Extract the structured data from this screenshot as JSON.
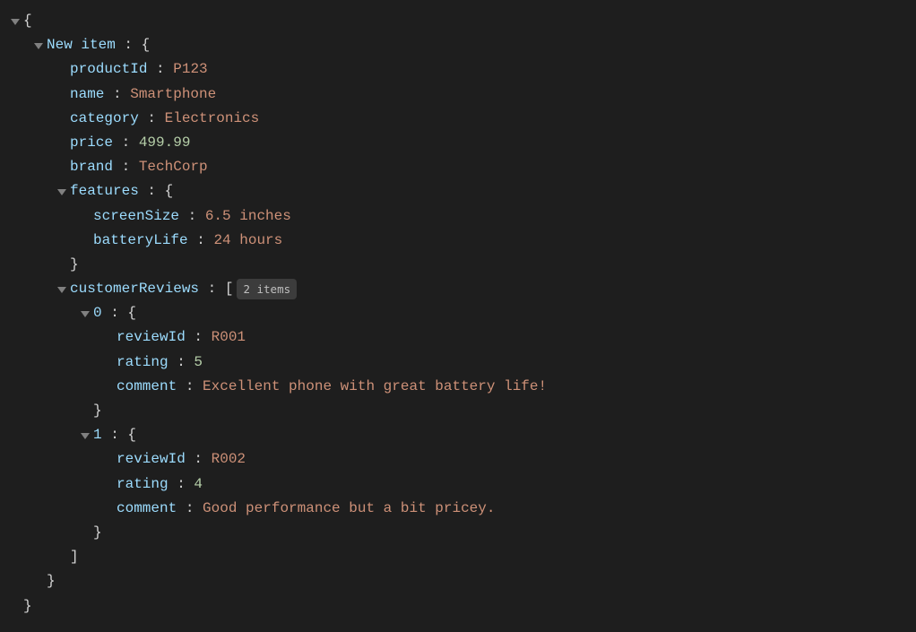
{
  "root": {
    "open": "{",
    "close": "}",
    "newItemKey": "New item",
    "props": {
      "productId": {
        "k": "productId",
        "v": "P123",
        "t": "str"
      },
      "name": {
        "k": "name",
        "v": "Smartphone",
        "t": "str"
      },
      "category": {
        "k": "category",
        "v": "Electronics",
        "t": "str"
      },
      "price": {
        "k": "price",
        "v": "499.99",
        "t": "num"
      },
      "brand": {
        "k": "brand",
        "v": "TechCorp",
        "t": "str"
      }
    },
    "features": {
      "key": "features",
      "screenSize": {
        "k": "screenSize",
        "v": "6.5 inches",
        "t": "str"
      },
      "batteryLife": {
        "k": "batteryLife",
        "v": "24 hours",
        "t": "str"
      }
    },
    "customerReviews": {
      "key": "customerReviews",
      "badge": "2 items",
      "openArr": "[",
      "closeArr": "]",
      "items": [
        {
          "idx": "0",
          "reviewId": {
            "k": "reviewId",
            "v": "R001",
            "t": "str"
          },
          "rating": {
            "k": "rating",
            "v": "5",
            "t": "num"
          },
          "comment": {
            "k": "comment",
            "v": "Excellent phone with great battery life!",
            "t": "str"
          }
        },
        {
          "idx": "1",
          "reviewId": {
            "k": "reviewId",
            "v": "R002",
            "t": "str"
          },
          "rating": {
            "k": "rating",
            "v": "4",
            "t": "num"
          },
          "comment": {
            "k": "comment",
            "v": "Good performance but a bit pricey.",
            "t": "str"
          }
        }
      ]
    }
  },
  "sep": " : "
}
